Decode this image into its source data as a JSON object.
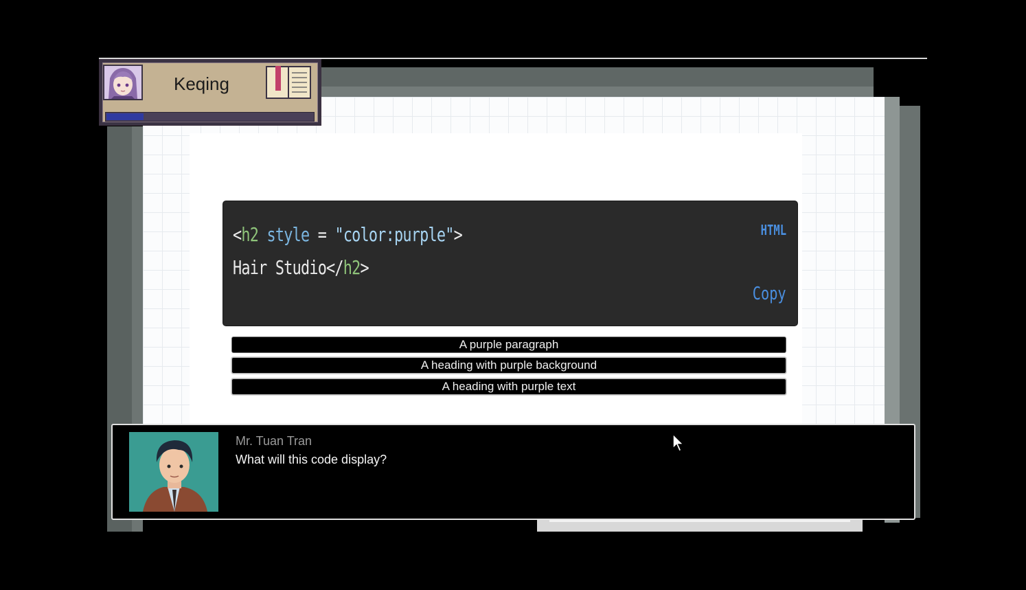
{
  "player": {
    "name": "Keqing",
    "xp_fraction": 0.18
  },
  "code_block": {
    "language": "HTML",
    "copy_label": "Copy",
    "line1": {
      "open": "<",
      "tag": "h2",
      "attr": " style",
      "eq": " = ",
      "value": "\"color:purple\"",
      "close": ">"
    },
    "line2": {
      "text": "Hair Studio",
      "open_close": "</",
      "tag": "h2",
      "close": ">"
    }
  },
  "options": [
    "A purple paragraph",
    "A heading with purple background",
    "A heading with purple text"
  ],
  "dialogue": {
    "speaker": "Mr. Tuan Tran",
    "text": "What will this code display?"
  },
  "colors": {
    "code_bg": "#2a2a2a",
    "code_link": "#4a8fe0",
    "hud_bg": "#c4b293",
    "xp_fill": "#2f3aa0",
    "portrait_bg": "#3a9c92"
  },
  "icons": {
    "journal": "journal-book-icon",
    "cursor": "mouse-pointer-icon"
  }
}
